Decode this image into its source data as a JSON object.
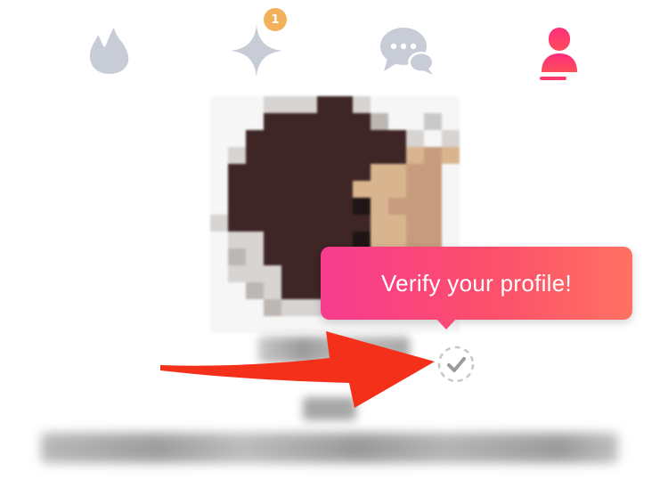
{
  "nav": {
    "items": [
      {
        "icon": "flame-icon",
        "active": false
      },
      {
        "icon": "sparkle-icon",
        "active": false,
        "badge": "1"
      },
      {
        "icon": "chat-icon",
        "active": false
      },
      {
        "icon": "profile-icon",
        "active": true
      }
    ]
  },
  "tooltip": {
    "text": "Verify your profile!"
  },
  "verification": {
    "icon": "checkmark-icon"
  },
  "colors": {
    "nav_inactive": "#c7ccd6",
    "nav_active": "#fd3a6b",
    "badge": "#f2b15a",
    "tooltip_start": "#f73c8f",
    "tooltip_end": "#ff7162",
    "arrow": "#f4301b",
    "badge_outline": "#c8c8c8"
  }
}
